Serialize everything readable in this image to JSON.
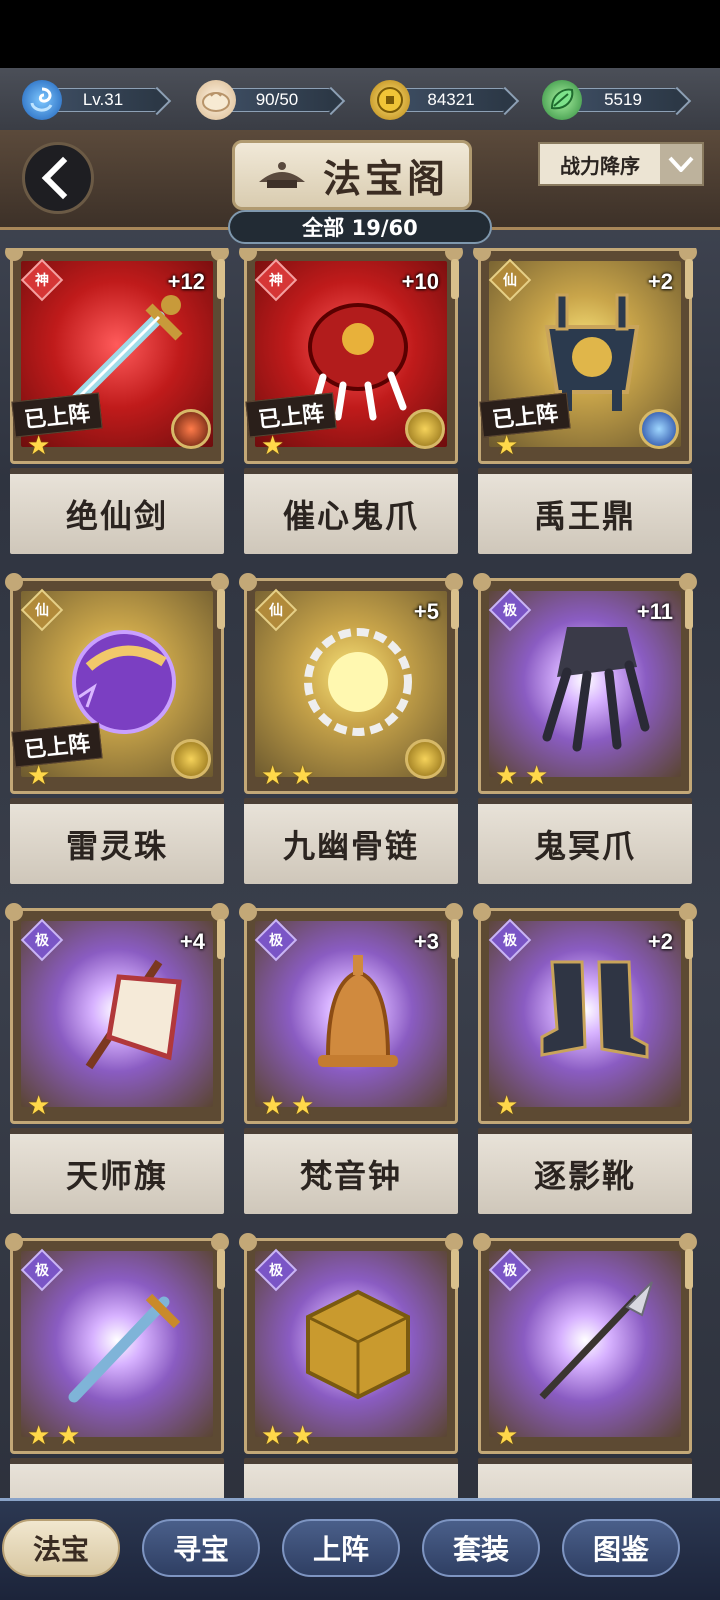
{
  "resources": [
    {
      "icon": "level-swirl-icon",
      "value": "Lv.31"
    },
    {
      "icon": "bun-icon",
      "value": "90/50"
    },
    {
      "icon": "coin-icon",
      "value": "84321"
    },
    {
      "icon": "jade-leaf-icon",
      "value": "5519"
    }
  ],
  "header": {
    "title": "法宝阁",
    "sort_label": "战力降序",
    "count_label": "全部 19/60"
  },
  "items": [
    {
      "name": "绝仙剑",
      "grade": "神",
      "plus": "+12",
      "deployed": "已上阵",
      "stars": 1,
      "bg": "red",
      "icon": "sword-icon",
      "skill_icon": "fire"
    },
    {
      "name": "催心鬼爪",
      "grade": "神",
      "plus": "+10",
      "deployed": "已上阵",
      "stars": 1,
      "bg": "red",
      "icon": "claw-gauntlet-icon",
      "skill_icon": "coin"
    },
    {
      "name": "禹王鼎",
      "grade": "仙",
      "plus": "+2",
      "deployed": "已上阵",
      "stars": 1,
      "bg": "gold",
      "icon": "cauldron-icon",
      "skill_icon": "blue"
    },
    {
      "name": "雷灵珠",
      "grade": "仙",
      "plus": "",
      "deployed": "已上阵",
      "stars": 1,
      "bg": "gold",
      "icon": "thunder-orb-icon",
      "skill_icon": "coin"
    },
    {
      "name": "九幽骨链",
      "grade": "仙",
      "plus": "+5",
      "deployed": "",
      "stars": 2,
      "bg": "gold",
      "icon": "bone-chain-icon",
      "skill_icon": "coin"
    },
    {
      "name": "鬼冥爪",
      "grade": "极",
      "plus": "+11",
      "deployed": "",
      "stars": 2,
      "bg": "purple",
      "icon": "dark-claw-icon",
      "skill_icon": ""
    },
    {
      "name": "天师旗",
      "grade": "极",
      "plus": "+4",
      "deployed": "",
      "stars": 1,
      "bg": "purple",
      "icon": "banner-icon",
      "skill_icon": ""
    },
    {
      "name": "梵音钟",
      "grade": "极",
      "plus": "+3",
      "deployed": "",
      "stars": 2,
      "bg": "purple",
      "icon": "bell-icon",
      "skill_icon": ""
    },
    {
      "name": "逐影靴",
      "grade": "极",
      "plus": "+2",
      "deployed": "",
      "stars": 1,
      "bg": "purple",
      "icon": "boots-icon",
      "skill_icon": ""
    },
    {
      "name": "",
      "grade": "极",
      "plus": "",
      "deployed": "",
      "stars": 2,
      "bg": "purple",
      "icon": "blue-sword-icon",
      "skill_icon": ""
    },
    {
      "name": "",
      "grade": "极",
      "plus": "",
      "deployed": "",
      "stars": 2,
      "bg": "purple",
      "icon": "gold-cube-icon",
      "skill_icon": ""
    },
    {
      "name": "",
      "grade": "极",
      "plus": "",
      "deployed": "",
      "stars": 1,
      "bg": "purple",
      "icon": "spear-icon",
      "skill_icon": ""
    }
  ],
  "nav": [
    {
      "label": "法宝",
      "active": true
    },
    {
      "label": "寻宝",
      "active": false
    },
    {
      "label": "上阵",
      "active": false
    },
    {
      "label": "套装",
      "active": false
    },
    {
      "label": "图鉴",
      "active": false
    }
  ]
}
